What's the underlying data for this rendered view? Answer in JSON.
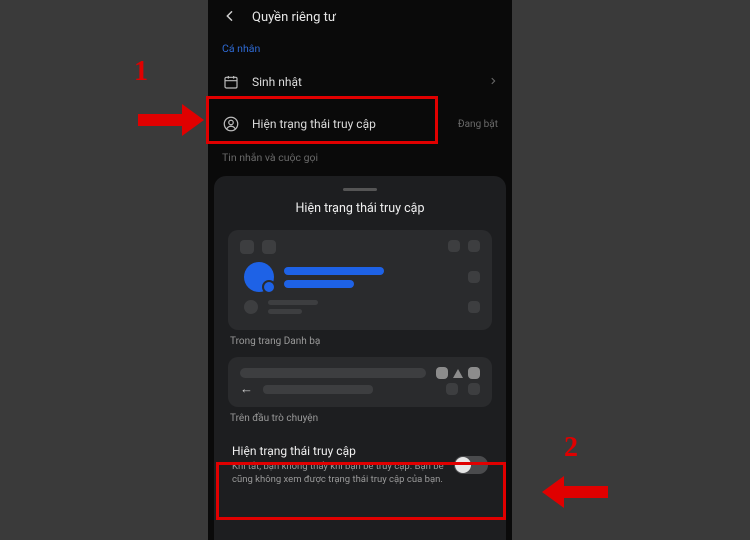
{
  "header": {
    "title": "Quyền riêng tư"
  },
  "sections": {
    "personal_label": "Cá nhân",
    "messages_label": "Tin nhắn và cuộc gọi"
  },
  "rows": {
    "birthday": {
      "label": "Sinh nhật"
    },
    "active_status": {
      "label": "Hiện trạng thái truy cập",
      "trailing": "Đang bật"
    }
  },
  "sheet": {
    "title": "Hiện trạng thái truy cập",
    "caption1": "Trong trang Danh bạ",
    "caption2": "Trên đầu trò chuyện",
    "setting_title": "Hiện trạng thái truy cập",
    "setting_desc": "Khi tắt, bạn không thấy khi bạn bè truy cập. Bạn bè cũng không xem được trạng thái truy cập của bạn.",
    "toggle_on": false
  },
  "annotations": {
    "label1": "1",
    "label2": "2"
  }
}
